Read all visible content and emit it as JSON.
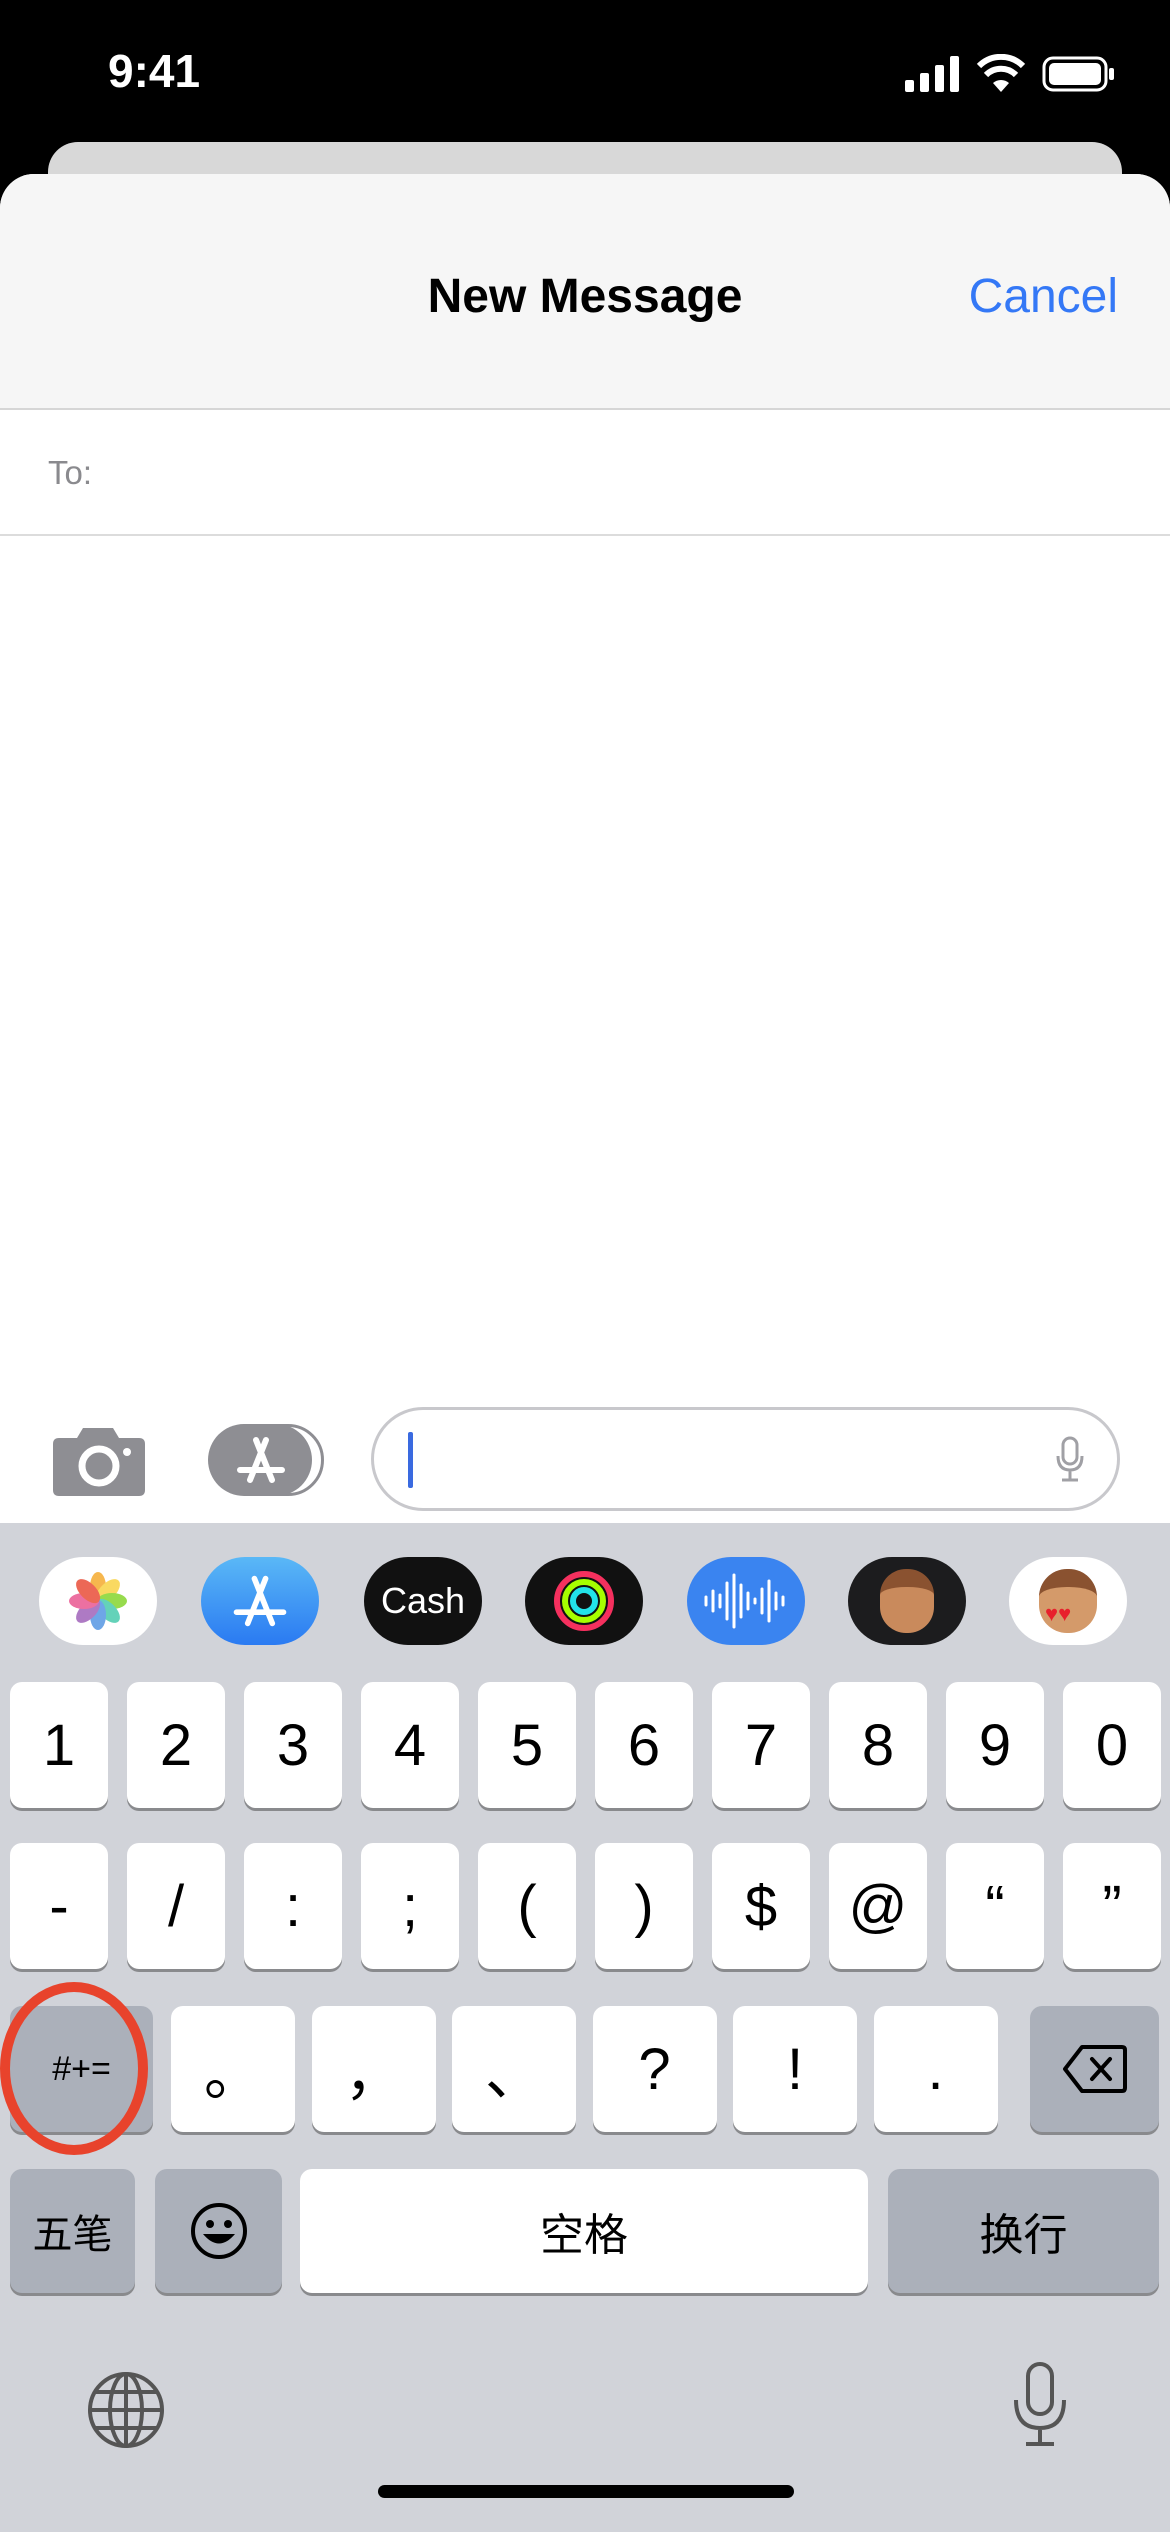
{
  "status_bar": {
    "time": "9:41",
    "icons": [
      "signal-icon",
      "wifi-icon",
      "battery-icon"
    ]
  },
  "header": {
    "title": "New Message",
    "cancel": "Cancel"
  },
  "to": {
    "label": "To:",
    "value": ""
  },
  "compose": {
    "value": "",
    "placeholder": "",
    "icons": [
      "camera-icon",
      "app-store-icon",
      "microphone-icon"
    ]
  },
  "app_strip": [
    {
      "name": "Photos"
    },
    {
      "name": "App Store"
    },
    {
      "name": "Cash",
      "label": "Cash"
    },
    {
      "name": "Activity"
    },
    {
      "name": "Audio"
    },
    {
      "name": "Memoji"
    },
    {
      "name": "Memoji Stickers"
    }
  ],
  "keyboard": {
    "row1": [
      "1",
      "2",
      "3",
      "4",
      "5",
      "6",
      "7",
      "8",
      "9",
      "0"
    ],
    "row2": [
      "-",
      "/",
      ":",
      ";",
      "(",
      ")",
      "$",
      "@",
      "“",
      "”"
    ],
    "row3": [
      "。",
      "，",
      "、",
      "?",
      "!",
      "."
    ],
    "symbols": "#+=",
    "ime": "五笔",
    "space": "空格",
    "return": "换行"
  },
  "highlight_color": "#e8432c",
  "accent": "#3478f6"
}
